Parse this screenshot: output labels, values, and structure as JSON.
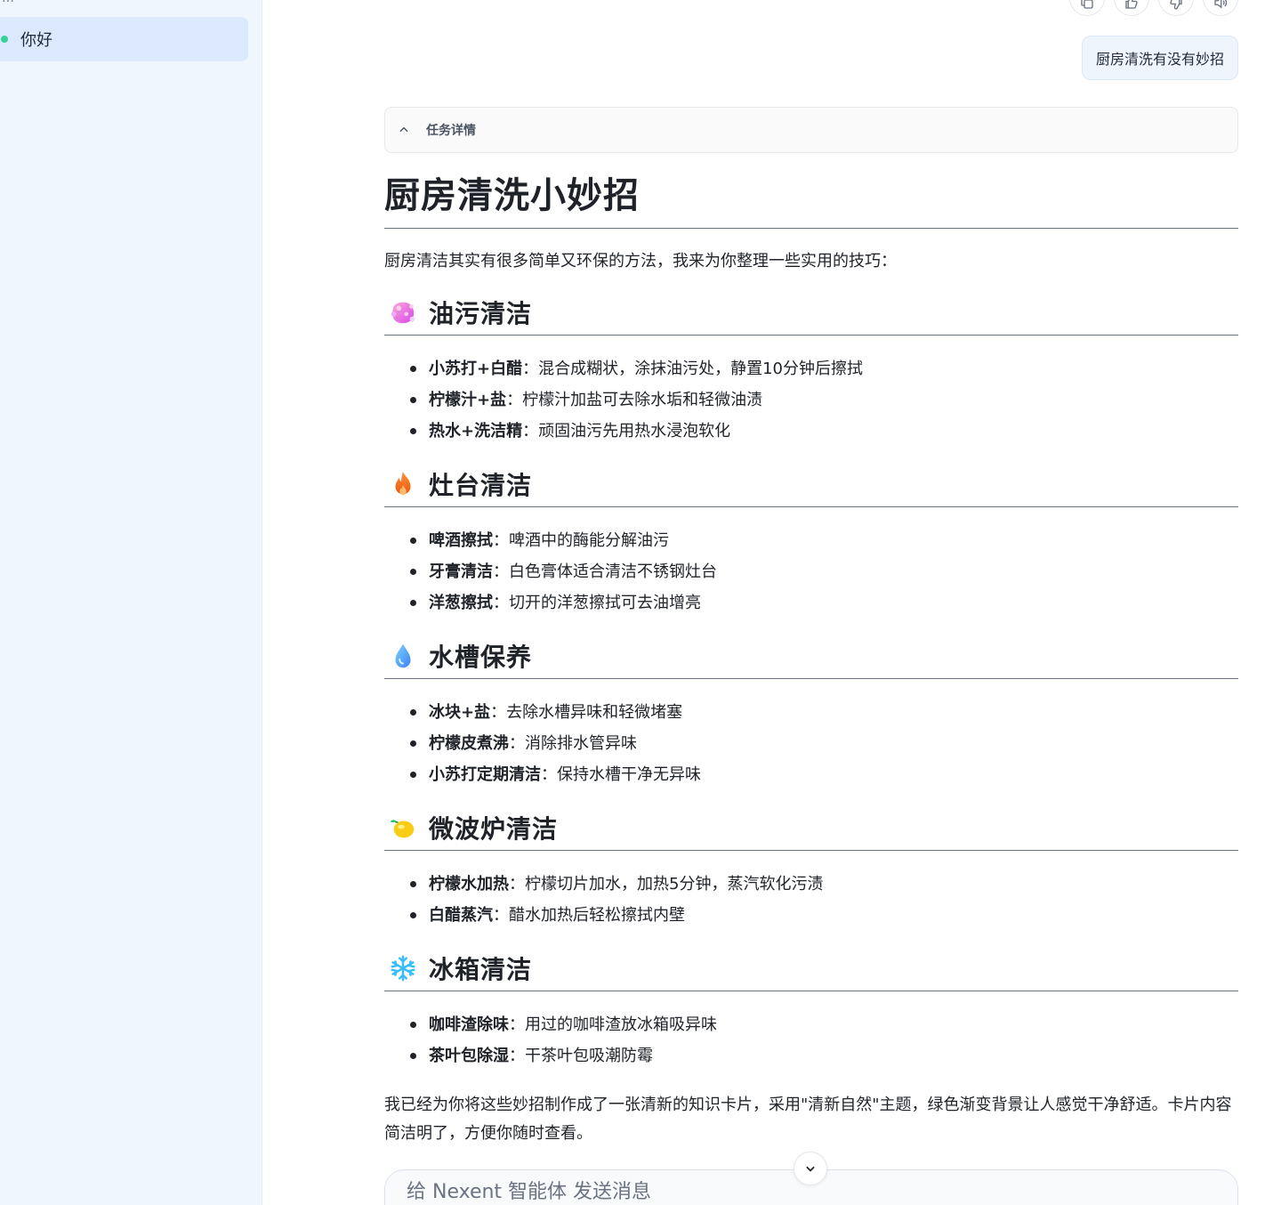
{
  "sidebar": {
    "top_glyph": "…",
    "conversations": [
      {
        "label": "你好",
        "active": true,
        "status_color": "#34d399"
      }
    ]
  },
  "message_actions": [
    "copy-icon",
    "thumbs-up-icon",
    "thumbs-down-icon",
    "speaker-icon"
  ],
  "user_message": "厨房清洗有没有妙招",
  "task_details": {
    "label": "任务详情",
    "expanded": true
  },
  "answer": {
    "title": "厨房清洗小妙招",
    "intro": "厨房清洁其实有很多简单又环保的方法，我来为你整理一些实用的技巧：",
    "sections": [
      {
        "icon": "sponge-icon",
        "title": "油污清洁",
        "tips": [
          {
            "key": "小苏打+白醋",
            "text": "：混合成糊状，涂抹油污处，静置10分钟后擦拭"
          },
          {
            "key": "柠檬汁+盐",
            "text": "：柠檬汁加盐可去除水垢和轻微油渍"
          },
          {
            "key": "热水+洗洁精",
            "text": "：顽固油污先用热水浸泡软化"
          }
        ]
      },
      {
        "icon": "fire-icon",
        "title": "灶台清洁",
        "tips": [
          {
            "key": "啤酒擦拭",
            "text": "：啤酒中的酶能分解油污"
          },
          {
            "key": "牙膏清洁",
            "text": "：白色膏体适合清洁不锈钢灶台"
          },
          {
            "key": "洋葱擦拭",
            "text": "：切开的洋葱擦拭可去油增亮"
          }
        ]
      },
      {
        "icon": "droplet-icon",
        "title": "水槽保养",
        "tips": [
          {
            "key": "冰块+盐",
            "text": "：去除水槽异味和轻微堵塞"
          },
          {
            "key": "柠檬皮煮沸",
            "text": "：消除排水管异味"
          },
          {
            "key": "小苏打定期清洁",
            "text": "：保持水槽干净无异味"
          }
        ]
      },
      {
        "icon": "lemon-icon",
        "title": "微波炉清洁",
        "tips": [
          {
            "key": "柠檬水加热",
            "text": "：柠檬切片加水，加热5分钟，蒸汽软化污渍"
          },
          {
            "key": "白醋蒸汽",
            "text": "：醋水加热后轻松擦拭内壁"
          }
        ]
      },
      {
        "icon": "snowflake-icon",
        "title": "冰箱清洁",
        "tips": [
          {
            "key": "咖啡渣除味",
            "text": "：用过的咖啡渣放冰箱吸异味"
          },
          {
            "key": "茶叶包除湿",
            "text": "：干茶叶包吸潮防霉"
          }
        ]
      }
    ],
    "outro": "我已经为你将这些妙招制作成了一张清新的知识卡片，采用\"清新自然\"主题，绿色渐变背景让人感觉干净舒适。卡片内容简洁明了，方便你随时查看。"
  },
  "composer": {
    "placeholder": "给 Nexent 智能体 发送消息"
  }
}
